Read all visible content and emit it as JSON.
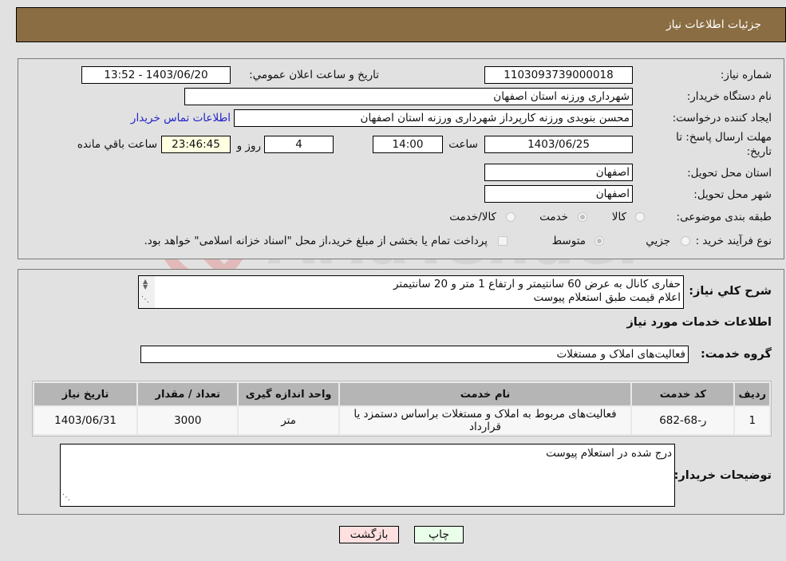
{
  "header": {
    "title": "جزئیات اطلاعات نیاز"
  },
  "form": {
    "need_number": {
      "label": "شماره نیاز:",
      "value": "1103093739000018"
    },
    "announce_datetime": {
      "label": "تاریخ و ساعت اعلان عمومي:",
      "value": "1403/06/20 - 13:52"
    },
    "buyer_org": {
      "label": "نام دستگاه خریدار:",
      "value": "شهرداری ورزنه استان اصفهان"
    },
    "requester": {
      "label": "ایجاد کننده درخواست:",
      "value": "محسن بنویدی ورزنه کارپرداز شهرداری ورزنه استان اصفهان"
    },
    "buyer_contact_link": "اطلاعات تماس خریدار",
    "deadline": {
      "label_line1": "مهلت ارسال پاسخ: تا",
      "label_line2": "تاریخ:",
      "date": "1403/06/25",
      "time_label": "ساعت",
      "time": "14:00",
      "days": "4",
      "days_label": "روز و",
      "remaining": "23:46:45",
      "remaining_label": "ساعت باقي مانده"
    },
    "delivery_province": {
      "label": "استان محل تحویل:",
      "value": "اصفهان"
    },
    "delivery_city": {
      "label": "شهر محل تحویل:",
      "value": "اصفهان"
    },
    "category": {
      "label": "طبقه بندی موضوعی:",
      "options": [
        "کالا",
        "خدمت",
        "کالا/خدمت"
      ],
      "selected": "خدمت"
    },
    "purchase_type": {
      "label": "نوع فرآیند خرید :",
      "options": [
        "جزيي",
        "متوسط"
      ],
      "selected": "متوسط",
      "treasury_note": "پرداخت تمام یا بخشی از مبلغ خرید،از محل \"اسناد خزانه اسلامی\" خواهد بود.",
      "treasury_checked": false
    }
  },
  "description": {
    "label": "شرح كلي نياز:",
    "lines": [
      "حفاری کانال به عرض 60 سانتیمتر و ارتفاع 1 متر و 20 سانتیمتر",
      "اعلام قیمت طبق استعلام پیوست"
    ]
  },
  "services": {
    "section_title": "اطلاعات خدمات مورد نیاز",
    "group_label": "گروه خدمت:",
    "group_value": "فعالیت‌های  املاک و مستغلات",
    "columns": [
      "ردیف",
      "کد خدمت",
      "نام خدمت",
      "واحد اندازه گیری",
      "تعداد / مقدار",
      "تاریخ نیاز"
    ],
    "rows": [
      [
        "1",
        "ر-68-682",
        "فعالیت‌های مربوط به املاک و مستغلات براساس دستمزد یا قرارداد",
        "متر",
        "3000",
        "1403/06/31"
      ]
    ]
  },
  "buyer_notes": {
    "label": "توضیحات خریدار:",
    "value": "درج شده در استعلام پیوست"
  },
  "buttons": {
    "print": "چاپ",
    "back": "بازگشت"
  },
  "colors": {
    "header_bg": "#8b6d43",
    "print_bg": "#eaffea",
    "back_bg": "#ffe0e0",
    "link": "#2222cc"
  }
}
